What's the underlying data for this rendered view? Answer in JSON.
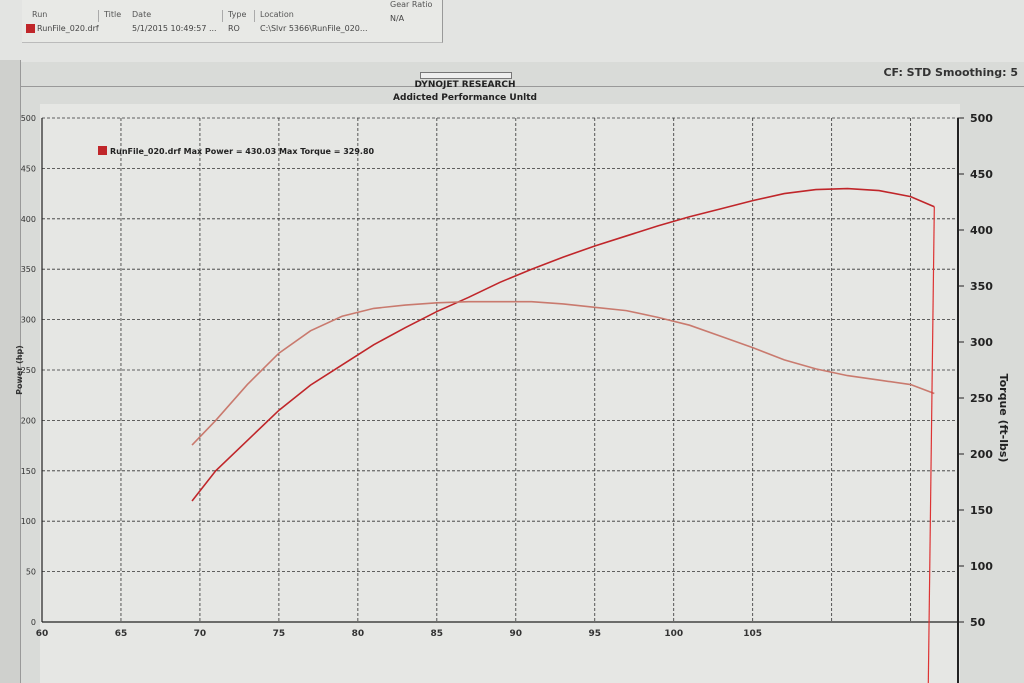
{
  "run_table": {
    "headers": [
      "Run",
      "Title",
      "Date",
      "Type",
      "Location",
      "Gear Ratio"
    ],
    "row": {
      "run": "RunFile_020.drf",
      "date": "5/1/2015 10:49:57 ...",
      "type": "RO",
      "location": "C:\\Slvr 5366\\RunFile_020...",
      "gear_ratio": "N/A"
    }
  },
  "header": {
    "cf_info": "CF: STD  Smoothing: 5",
    "title_line1": "DYNOJET RESEARCH",
    "title_line2": "Addicted Performance Unltd"
  },
  "legend": {
    "text": "RunFile_020.drf Max Power = 430.03 Max Torque = 329.80",
    "color": "#c0262a"
  },
  "chart_data": {
    "type": "line",
    "title": "DYNOJET RESEARCH",
    "subtitle": "Addicted Performance Unltd",
    "xlabel": "",
    "ylabel_left": "Power (hp)",
    "ylabel_right": "Torque (ft-lbs)",
    "x_ticks": [
      60,
      65,
      70,
      75,
      80,
      85,
      90,
      95,
      100,
      105
    ],
    "y_left_ticks": [
      0,
      50,
      100,
      150,
      200,
      250,
      300,
      350,
      400,
      450,
      500
    ],
    "y_right_ticks": [
      50,
      100,
      150,
      200,
      250,
      300,
      350,
      400,
      450,
      500
    ],
    "xlim": [
      60,
      118
    ],
    "ylim_left": [
      0,
      500
    ],
    "ylim_right": [
      50,
      500
    ],
    "grid": true,
    "legend_position": "top-left",
    "series": [
      {
        "name": "Power",
        "axis": "left",
        "color": "#c0262a",
        "x": [
          69.5,
          71,
          73,
          75,
          77,
          79,
          81,
          83,
          85,
          87,
          89,
          91,
          93,
          95,
          97,
          99,
          101,
          103,
          105,
          107,
          109,
          111,
          113,
          115,
          116.5
        ],
        "y": [
          120,
          150,
          180,
          210,
          235,
          255,
          275,
          292,
          308,
          322,
          337,
          350,
          362,
          373,
          383,
          393,
          402,
          410,
          418,
          425,
          429,
          430,
          428,
          422,
          412
        ]
      },
      {
        "name": "Torque",
        "axis": "right",
        "color": "#c97a6e",
        "x": [
          69.5,
          71,
          73,
          75,
          77,
          79,
          81,
          83,
          85,
          87,
          89,
          91,
          93,
          95,
          97,
          99,
          101,
          103,
          105,
          107,
          109,
          111,
          113,
          115,
          116.5
        ],
        "y": [
          208,
          230,
          262,
          290,
          310,
          323,
          330,
          333,
          335,
          336,
          336,
          336,
          334,
          331,
          328,
          322,
          315,
          305,
          295,
          284,
          276,
          270,
          266,
          262,
          254
        ]
      }
    ]
  }
}
